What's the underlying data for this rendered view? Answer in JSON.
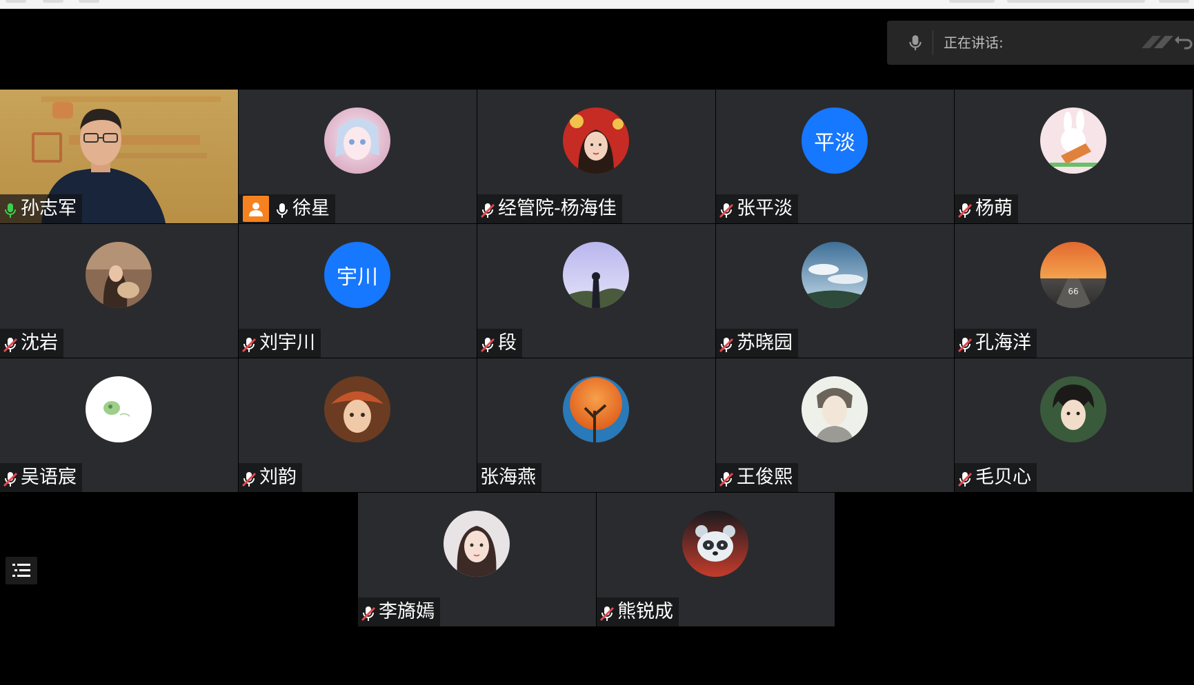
{
  "speaking": {
    "label": "正在讲话:"
  },
  "participants": [
    {
      "name": "孙志军",
      "mic": "active",
      "avatar": "video",
      "host": false
    },
    {
      "name": "徐星",
      "mic": "on",
      "avatar": "anime-girl",
      "host": true
    },
    {
      "name": "经管院-杨海佳",
      "mic": "muted",
      "avatar": "girl-red",
      "host": false
    },
    {
      "name": "张平淡",
      "mic": "muted",
      "avatar_text": "平淡",
      "host": false
    },
    {
      "name": "杨萌",
      "mic": "muted",
      "avatar": "bunny",
      "host": false
    },
    {
      "name": "沈岩",
      "mic": "muted",
      "avatar": "guitar-girl",
      "host": false
    },
    {
      "name": "刘宇川",
      "mic": "muted",
      "avatar_text": "宇川",
      "host": false
    },
    {
      "name": "段",
      "mic": "muted",
      "avatar": "lavender-sky",
      "host": false
    },
    {
      "name": "苏晓园",
      "mic": "muted",
      "avatar": "cloudy-sky",
      "host": false
    },
    {
      "name": "孔海洋",
      "mic": "muted",
      "avatar": "sunset-road",
      "host": false
    },
    {
      "name": "吴语宸",
      "mic": "muted",
      "avatar": "green-fruit",
      "host": false
    },
    {
      "name": "刘韵",
      "mic": "muted",
      "avatar": "hat-girl",
      "host": false
    },
    {
      "name": "张海燕",
      "mic": "none",
      "avatar": "orange-tree",
      "host": false
    },
    {
      "name": "王俊熙",
      "mic": "muted",
      "avatar": "sketch-boy",
      "host": false
    },
    {
      "name": "毛贝心",
      "mic": "muted",
      "avatar": "anime-boy",
      "host": false
    },
    {
      "name": "李旖嫣",
      "mic": "muted",
      "avatar": "portrait-girl",
      "host": false
    },
    {
      "name": "熊锐成",
      "mic": "muted",
      "avatar": "raccoon",
      "host": false
    }
  ],
  "colors": {
    "tile": "#2a2b2e",
    "avatar_blue": "#1677ff",
    "host_badge": "#f5821f",
    "mic_active": "#3ccf4e",
    "mic_muted": "#e5484d"
  }
}
